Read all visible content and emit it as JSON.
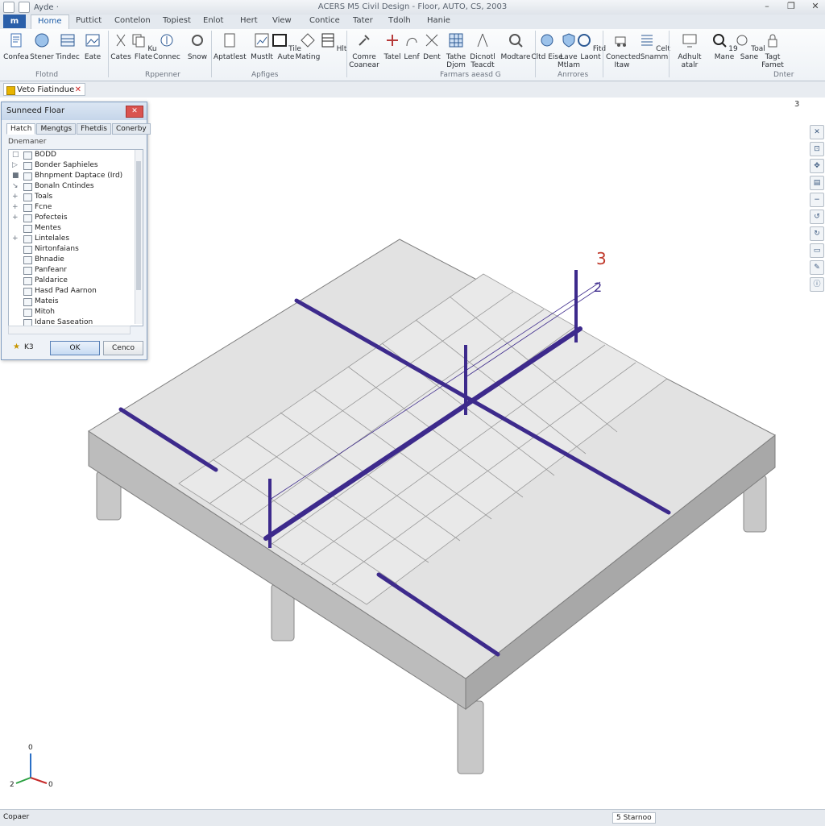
{
  "window": {
    "title": "ACERS M5 Civil Design - Floor, AUTO, CS, 2003",
    "quick_access": "Ayde ·"
  },
  "menu_tabs": [
    "Home",
    "Puttict",
    "Contelon",
    "Topiest",
    "Enlot",
    "Hert",
    "View",
    "Contice",
    "Tater",
    "Tdolh",
    "Hanie"
  ],
  "file_tab": "m",
  "ribbon": {
    "buttons": [
      "Confea",
      "Stener",
      "Tindec",
      "Eate",
      "Cates",
      "Ku Flate",
      "Connec",
      "Snow",
      "Aptatlest",
      "Mustlt",
      "Tile Aute",
      "Mating",
      "Hlt",
      "Comre Coanear",
      "Tatel",
      "Lenf",
      "Dent",
      "Tathe Djom",
      "Dicnotl Teacdt",
      "Modtare",
      "Cltd Eise",
      "Lave Mtlam",
      "Fitd Laont",
      "Conected Itaw",
      "Celt Snamm",
      "Adhult atalr",
      "19 Mane",
      "Toal Sane",
      "Tagt Famet"
    ],
    "groups": [
      "Flotnd",
      "Rppenner",
      "Apfiges",
      "Farmars aeasd G",
      "Anrrores",
      "Dnter"
    ]
  },
  "doc_tab": {
    "label": "Veto Fiatindue"
  },
  "viewport": {
    "tab_count": "3",
    "axis_x": "2",
    "axis_y": "0",
    "axis_z": "0",
    "label_3": "3",
    "label_2": "2"
  },
  "dialog": {
    "title": "Sunneed Floar",
    "tabs": [
      "Hatch",
      "Mengtgs",
      "Fhetdis",
      "Conerby"
    ],
    "subheader": "Dnemaner",
    "tree": [
      "BODD",
      "Bonder Saphieles",
      "Bhnpment Daptace (Ird)",
      "Bonaln Cntindes",
      "Toals",
      "Fcne",
      "Pofecteis",
      "Mentes",
      "Lintelales",
      "Nirtonfaians",
      "Bhnadie",
      "Panfeanr",
      "Paldarice",
      "Hasd Pad Aarnon",
      "Mateis",
      "Mitoh",
      "Idane Saseation"
    ],
    "star_label": "K3",
    "ok": "OK",
    "cancel": "Cenco"
  },
  "status": {
    "left": "Copaer",
    "badge": "5 Starnoo"
  },
  "colors": {
    "beam": "#3d2a8c",
    "slab": "#d7d7d7",
    "accent": "#2a5fa9"
  }
}
